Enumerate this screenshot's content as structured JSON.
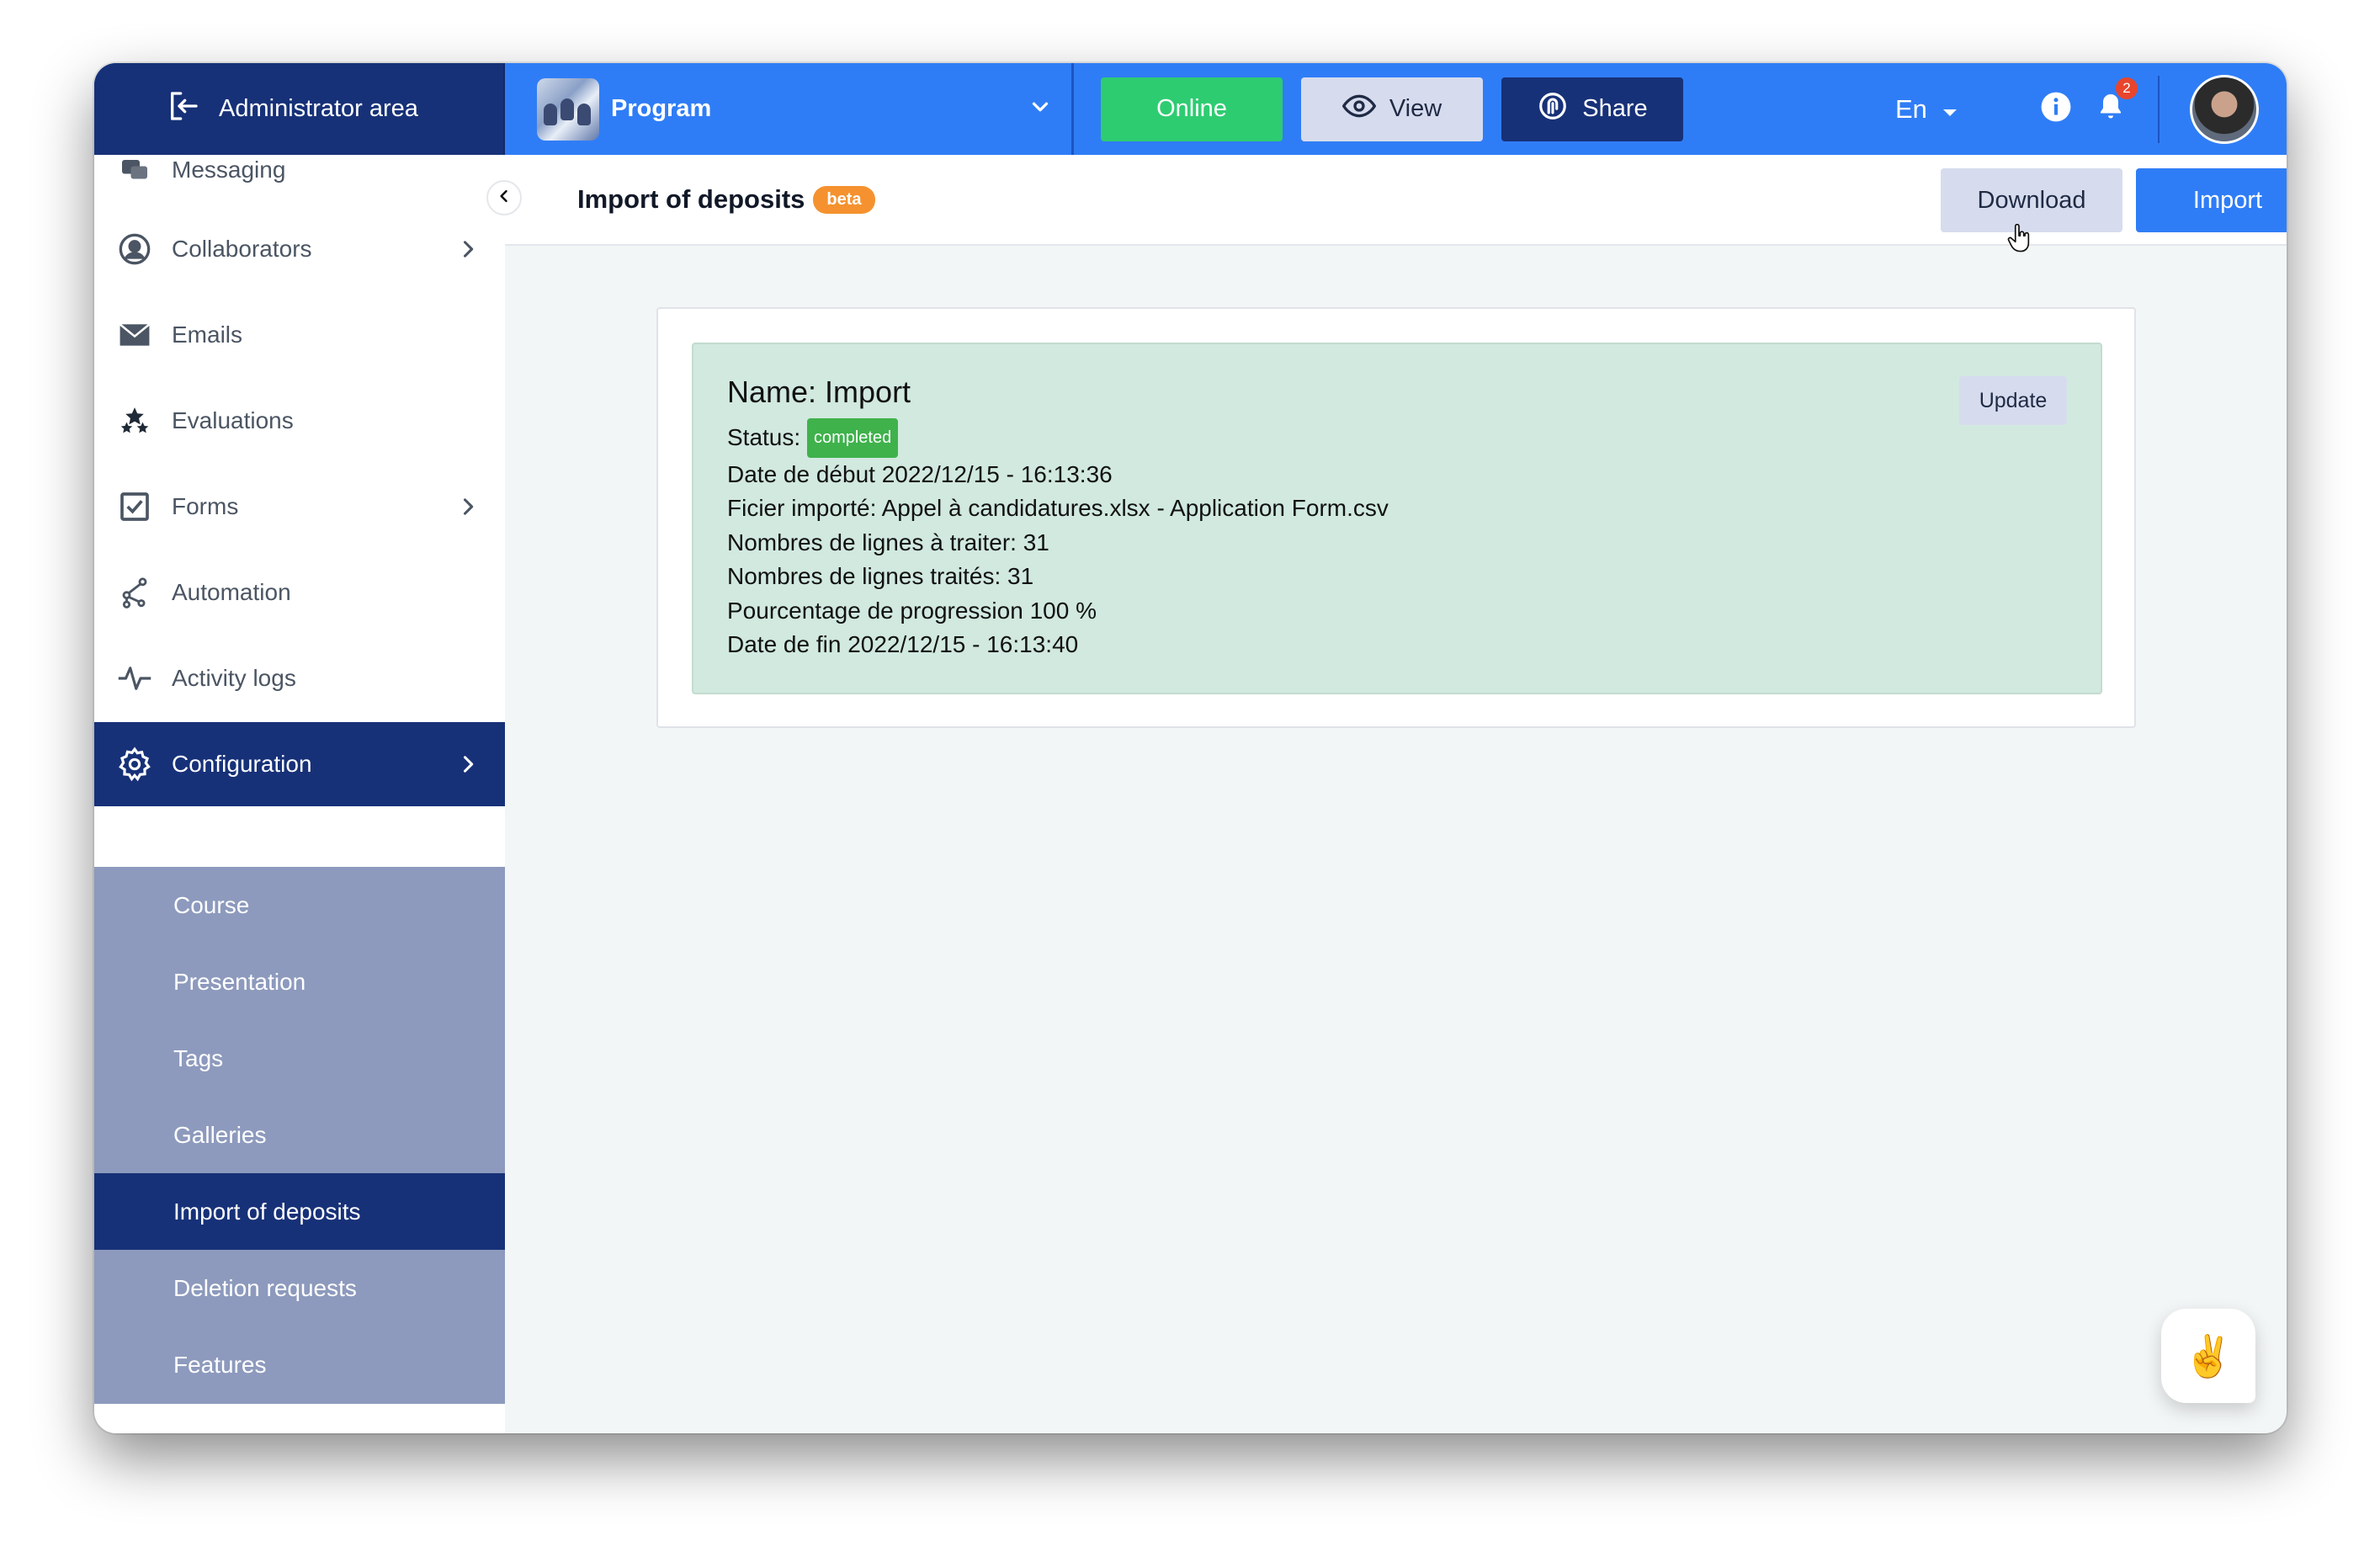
{
  "topbar": {
    "admin_area_label": "Administrator area",
    "program_name": "Program",
    "online_label": "Online",
    "view_label": "View",
    "share_label": "Share",
    "language": "En",
    "notification_count": "2"
  },
  "sidebar": {
    "items": [
      {
        "label": "Messaging",
        "icon": "messaging-icon"
      },
      {
        "label": "Collaborators",
        "icon": "user-circle-icon"
      },
      {
        "label": "Emails",
        "icon": "envelope-icon"
      },
      {
        "label": "Evaluations",
        "icon": "stars-icon"
      },
      {
        "label": "Forms",
        "icon": "checkbox-icon"
      },
      {
        "label": "Automation",
        "icon": "automation-icon"
      },
      {
        "label": "Activity logs",
        "icon": "activity-icon"
      },
      {
        "label": "Configuration",
        "icon": "gear-icon"
      }
    ],
    "sub_items": [
      {
        "label": "Course"
      },
      {
        "label": "Presentation"
      },
      {
        "label": "Tags"
      },
      {
        "label": "Galleries"
      },
      {
        "label": "Import of deposits"
      },
      {
        "label": "Deletion requests"
      },
      {
        "label": "Features"
      }
    ]
  },
  "page": {
    "title": "Import of deposits",
    "beta_badge": "beta",
    "download_label": "Download",
    "import_label": "Import"
  },
  "import_result": {
    "name": "Name: Import",
    "status_label": "Status:",
    "status_value": "completed",
    "lines": [
      "Date de début 2022/12/15 - 16:13:36",
      "Ficier importé: Appel à candidatures.xlsx - Application Form.csv",
      "Nombres de lignes à traiter: 31",
      "Nombres de lignes traités: 31",
      "Pourcentage de progression 100 %",
      "Date de fin 2022/12/15 - 16:13:40"
    ],
    "update_label": "Update"
  },
  "chat_widget": {
    "emoji": "✌️"
  },
  "colors": {
    "primary_blue": "#2f7df6",
    "navy": "#173178",
    "online_green": "#2ecc71",
    "submenu_bg": "#8d9abd",
    "beta_orange": "#f5922f",
    "result_bg": "#d1e9df"
  }
}
